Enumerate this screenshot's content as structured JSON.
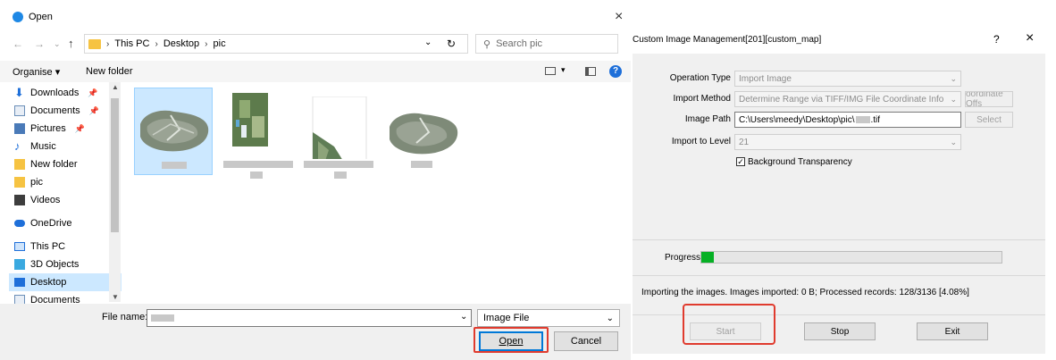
{
  "open_dialog": {
    "title": "Open",
    "close_glyph": "×",
    "breadcrumb": [
      "This PC",
      "Desktop",
      "pic"
    ],
    "search_placeholder": "Search pic",
    "organise_label": "Organise ▾",
    "new_folder_label": "New folder",
    "nav_items": [
      {
        "label": "Downloads",
        "icon": "download-icon",
        "pinned": true
      },
      {
        "label": "Documents",
        "icon": "document-icon",
        "pinned": true
      },
      {
        "label": "Pictures",
        "icon": "pictures-icon",
        "pinned": true
      },
      {
        "label": "Music",
        "icon": "music-icon",
        "pinned": false
      },
      {
        "label": "New folder",
        "icon": "folder-icon",
        "pinned": false
      },
      {
        "label": "pic",
        "icon": "folder-icon",
        "pinned": false
      },
      {
        "label": "Videos",
        "icon": "video-icon",
        "pinned": false
      },
      {
        "label": "OneDrive",
        "icon": "cloud-icon",
        "pinned": false
      },
      {
        "label": "This PC",
        "icon": "computer-icon",
        "pinned": false
      },
      {
        "label": "3D Objects",
        "icon": "cube-icon",
        "pinned": false
      },
      {
        "label": "Desktop",
        "icon": "desktop-icon",
        "pinned": false
      },
      {
        "label": "Documents",
        "icon": "document-icon",
        "pinned": false
      }
    ],
    "file_name_label": "File name:",
    "file_name_value": "",
    "file_type": "Image File",
    "open_button": "Open",
    "cancel_button": "Cancel"
  },
  "custom_image_mgmt": {
    "title": "Custom Image Management[201][custom_map]",
    "help_glyph": "?",
    "close_glyph": "×",
    "operation_type_label": "Operation Type",
    "operation_type_value": "Import Image",
    "import_method_label": "Import Method",
    "import_method_value": "Determine Range via TIFF/IMG File Coordinate Info",
    "coord_offset_button": "oordinate Offs",
    "image_path_label": "Image Path",
    "image_path_value": "C:\\Users\\meedy\\Desktop\\pic\\",
    "image_path_suffix": ".tif",
    "select_button": "Select",
    "import_level_label": "Import to Level",
    "import_level_value": "21",
    "bg_transparency_label": "Background Transparency",
    "bg_transparency_checked": true,
    "progress_label": "Progress",
    "progress_fraction": 0.0408,
    "status_text": "Importing the images. Images imported: 0 B; Processed records: 128/3136 [4.08%]",
    "start_button": "Start",
    "stop_button": "Stop",
    "exit_button": "Exit"
  },
  "colors": {
    "accent": "#0078d7",
    "highlight_box": "#e03b2e",
    "progress": "#06b025",
    "selection": "#cce8ff"
  }
}
